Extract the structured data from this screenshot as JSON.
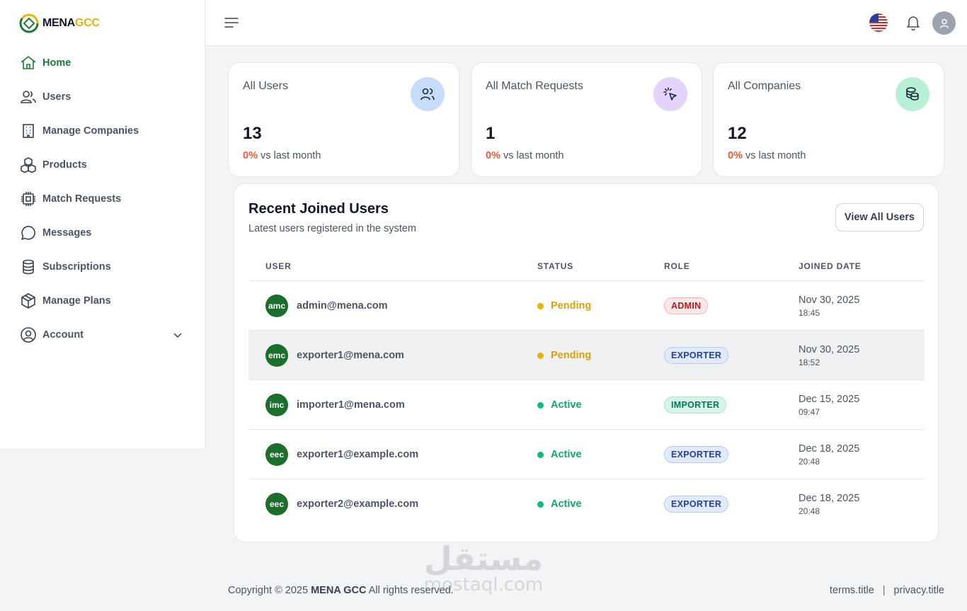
{
  "logo": {
    "part1": "MENA",
    "part2": "GCC"
  },
  "sidebar": {
    "items": [
      {
        "label": "Home",
        "icon": "home-icon"
      },
      {
        "label": "Users",
        "icon": "users-icon"
      },
      {
        "label": "Manage Companies",
        "icon": "building-icon"
      },
      {
        "label": "Products",
        "icon": "boxes-icon"
      },
      {
        "label": "Match Requests",
        "icon": "chip-icon"
      },
      {
        "label": "Messages",
        "icon": "message-circle-icon"
      },
      {
        "label": "Subscriptions",
        "icon": "database-icon"
      },
      {
        "label": "Manage Plans",
        "icon": "package-icon"
      },
      {
        "label": "Account",
        "icon": "user-circle-icon"
      }
    ],
    "active_color": "#1b7a35"
  },
  "stats": [
    {
      "title": "All Users",
      "value": "13",
      "change": "0%",
      "change_text": "vs last month",
      "icon": "users-icon",
      "icon_bg": "#c7dcfb"
    },
    {
      "title": "All Match Requests",
      "value": "1",
      "change": "0%",
      "change_text": "vs last month",
      "icon": "pointer-click-icon",
      "icon_bg": "#e4d3fb"
    },
    {
      "title": "All Companies",
      "value": "12",
      "change": "0%",
      "change_text": "vs last month",
      "icon": "coins-icon",
      "icon_bg": "#b8f0d6"
    }
  ],
  "recent": {
    "title": "Recent Joined Users",
    "subtitle": "Latest users registered in the system",
    "view_all": "View All Users",
    "columns": {
      "user": "USER",
      "status": "STATUS",
      "role": "ROLE",
      "joined": "JOINED DATE"
    },
    "rows": [
      {
        "initials": "amc",
        "email": "admin@mena.com",
        "status": "Pending",
        "role": "ADMIN",
        "date": "Nov 30, 2025",
        "time": "18:45"
      },
      {
        "initials": "emc",
        "email": "exporter1@mena.com",
        "status": "Pending",
        "role": "EXPORTER",
        "date": "Nov 30, 2025",
        "time": "18:52"
      },
      {
        "initials": "imc",
        "email": "importer1@mena.com",
        "status": "Active",
        "role": "IMPORTER",
        "date": "Dec 15, 2025",
        "time": "09:47"
      },
      {
        "initials": "eec",
        "email": "exporter1@example.com",
        "status": "Active",
        "role": "EXPORTER",
        "date": "Dec 18, 2025",
        "time": "20:48"
      },
      {
        "initials": "eec",
        "email": "exporter2@example.com",
        "status": "Active",
        "role": "EXPORTER",
        "date": "Dec 18, 2025",
        "time": "20:48"
      }
    ]
  },
  "footer": {
    "copyright_prefix": "Copyright © 2025",
    "brand": "MENA GCC",
    "copyright_suffix": "All rights reserved.",
    "terms": "terms.title",
    "separator": "|",
    "privacy": "privacy.title"
  },
  "watermark": {
    "arabic": "مستقل",
    "latin": "mostaql.com"
  }
}
